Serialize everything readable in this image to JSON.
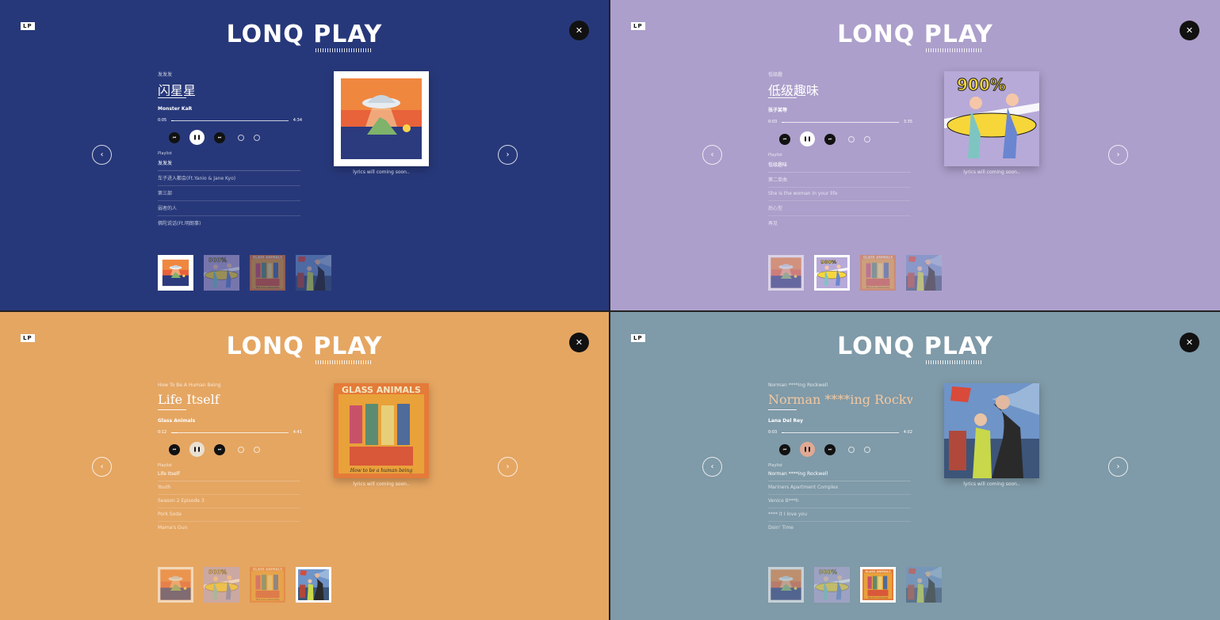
{
  "app": {
    "badge": "LP",
    "logo": "LONQ PLAY",
    "close_glyph": "✕",
    "prev_glyph": "‹",
    "next_glyph": "›",
    "playlist_label": "Playlist",
    "lyrics_note": "lyrics will coming soon..",
    "prev_icon": "chevron-left-icon",
    "next_icon": "chevron-right-icon"
  },
  "panels": [
    {
      "theme_color": "#27387a",
      "album": "发发发",
      "song_title": "闪星星",
      "artist": "Monster KaR",
      "time_elapsed": "0:05",
      "time_total": "4:34",
      "progress": 0.02,
      "play_button_color": "#ffffff",
      "playlist": [
        "发发发",
        "车子进入都会(Ft.Yanio & Jane Kyo)",
        "第三部",
        "弱者的人",
        "佛陀说话(Ft.明朗事)"
      ],
      "active_track_index": 0,
      "active_thumb_index": 0
    },
    {
      "theme_color": "#ac9fcb",
      "album": "低级趣",
      "song_title": "低级趣味",
      "artist": "张子某等",
      "time_elapsed": "0:03",
      "time_total": "3:35",
      "progress": 0.02,
      "play_button_color": "#ffffff",
      "playlist": [
        "低级趣味",
        "第二单曲",
        "She is the woman in your life",
        "后心型",
        "再见"
      ],
      "active_track_index": 0,
      "active_thumb_index": 1
    },
    {
      "theme_color": "#e5a662",
      "album": "How To Be A Human Being",
      "song_title": "Life Itself",
      "artist": "Glass Animals",
      "time_elapsed": "0:12",
      "time_total": "4:41",
      "progress": 0.05,
      "play_button_color": "#e9e0d2",
      "playlist": [
        "Life Itself",
        "Youth",
        "Season 2 Episode 3",
        "Pork Soda",
        "Mama's Gun"
      ],
      "active_track_index": 0,
      "active_thumb_index": 3
    },
    {
      "theme_color": "#7f9aa8",
      "album": "Norman ****ing Rockwell",
      "song_title": "Norman ****ing Rockwell",
      "artist": "Lana Del Rey",
      "time_elapsed": "0:03",
      "time_total": "4:02",
      "progress": 0.02,
      "play_button_color": "#e1a994",
      "playlist": [
        "Norman ****ing Rockwell",
        "Mariners Apartment Complex",
        "Venice B***h",
        "**** it I love you",
        "Doin' Time"
      ],
      "active_track_index": 0,
      "active_thumb_index": 2
    }
  ],
  "colors": {
    "title_p3": "#f2c8a2"
  }
}
